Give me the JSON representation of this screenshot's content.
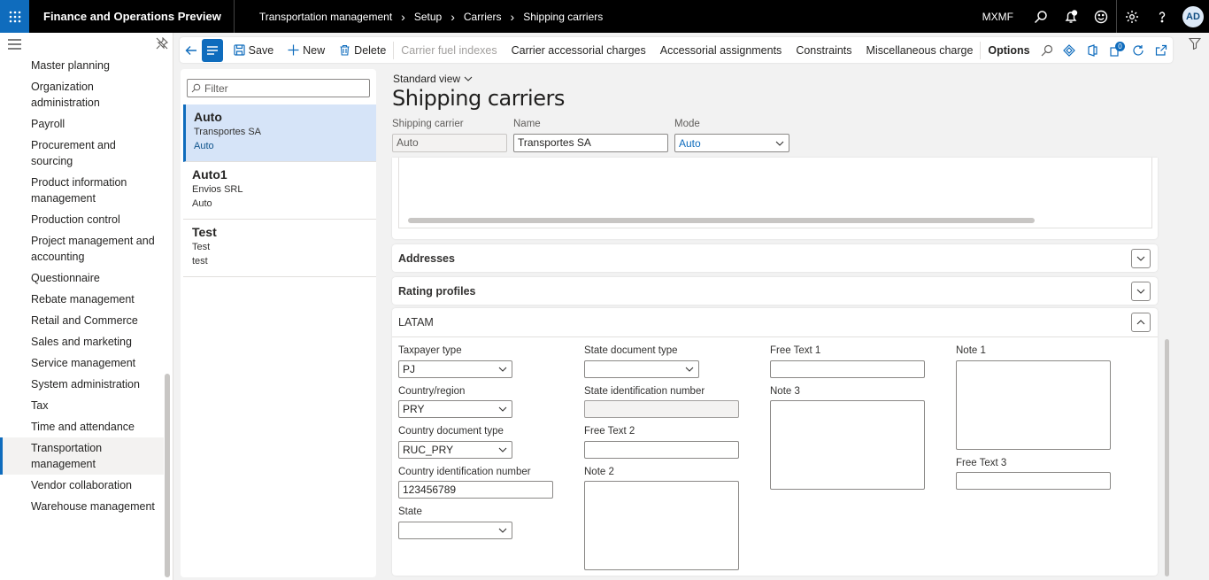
{
  "app": {
    "title": "Finance and Operations Preview",
    "company": "MXMF",
    "avatar": "AD"
  },
  "breadcrumbs": [
    "Transportation management",
    "Setup",
    "Carriers",
    "Shipping carriers"
  ],
  "nav": {
    "items": [
      "Master planning",
      "Organization administration",
      "Payroll",
      "Procurement and sourcing",
      "Product information management",
      "Production control",
      "Project management and accounting",
      "Questionnaire",
      "Rebate management",
      "Retail and Commerce",
      "Sales and marketing",
      "Service management",
      "System administration",
      "Tax",
      "Time and attendance",
      "Transportation management",
      "Vendor collaboration",
      "Warehouse management"
    ],
    "active": "Transportation management"
  },
  "actions": {
    "save": "Save",
    "new": "New",
    "delete": "Delete",
    "fuel": "Carrier fuel indexes",
    "accessorial": "Carrier accessorial charges",
    "assignments": "Accessorial assignments",
    "constraints": "Constraints",
    "misc": "Miscellaneous charge",
    "options": "Options",
    "badge": "0"
  },
  "list": {
    "filter_placeholder": "Filter",
    "records": [
      {
        "title": "Auto",
        "name": "Transportes SA",
        "mode": "Auto"
      },
      {
        "title": "Auto1",
        "name": "Envios SRL",
        "mode": "Auto"
      },
      {
        "title": "Test",
        "name": "Test",
        "mode": "test"
      }
    ]
  },
  "header": {
    "view": "Standard view",
    "title": "Shipping carriers",
    "carrier_label": "Shipping carrier",
    "carrier_value": "Auto",
    "name_label": "Name",
    "name_value": "Transportes SA",
    "mode_label": "Mode",
    "mode_value": "Auto"
  },
  "fasttabs": {
    "addresses": "Addresses",
    "rating": "Rating profiles",
    "latam": "LATAM"
  },
  "latam": {
    "taxpayer_label": "Taxpayer type",
    "taxpayer_value": "PJ",
    "country_label": "Country/region",
    "country_value": "PRY",
    "cdoc_label": "Country document type",
    "cdoc_value": "RUC_PRY",
    "cid_label": "Country identification number",
    "cid_value": "123456789",
    "state_label": "State",
    "state_value": "",
    "sdoc_label": "State document type",
    "sdoc_value": "",
    "sid_label": "State identification number",
    "sid_value": "",
    "ft2_label": "Free Text 2",
    "ft2_value": "",
    "note2_label": "Note 2",
    "ft1_label": "Free Text 1",
    "ft1_value": "",
    "note3_label": "Note 3",
    "note1_label": "Note 1",
    "ft3_label": "Free Text 3",
    "ft3_value": ""
  }
}
